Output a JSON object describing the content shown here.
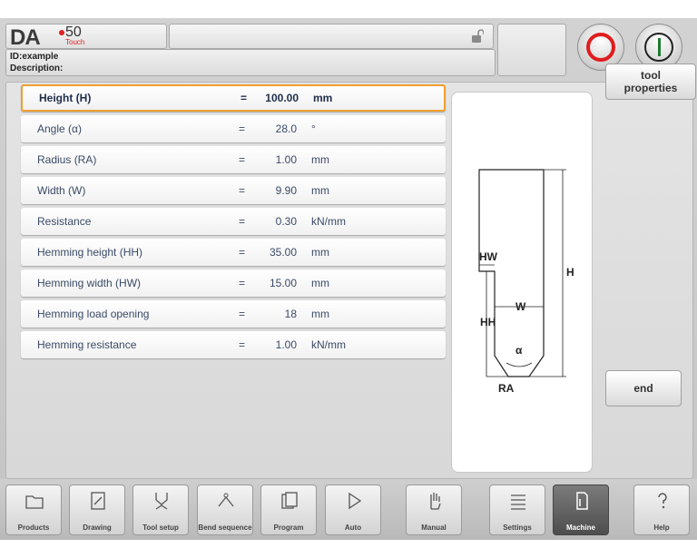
{
  "header": {
    "logo_brand": "DA",
    "logo_number": "50",
    "logo_sub": "Touch",
    "id_line": "ID:example",
    "description_line": "Description:"
  },
  "params": [
    {
      "label": "Height (H)",
      "eq": "=",
      "value": "100.00",
      "unit": "mm",
      "selected": true
    },
    {
      "label": "Angle (α)",
      "eq": "=",
      "value": "28.0",
      "unit": "°"
    },
    {
      "label": "Radius (RA)",
      "eq": "=",
      "value": "1.00",
      "unit": "mm"
    },
    {
      "label": "Width (W)",
      "eq": "=",
      "value": "9.90",
      "unit": "mm"
    },
    {
      "label": "Resistance",
      "eq": "=",
      "value": "0.30",
      "unit": "kN/mm"
    },
    {
      "label": "Hemming height (HH)",
      "eq": "=",
      "value": "35.00",
      "unit": "mm"
    },
    {
      "label": "Hemming width (HW)",
      "eq": "=",
      "value": "15.00",
      "unit": "mm"
    },
    {
      "label": "Hemming load opening",
      "eq": "=",
      "value": "18",
      "unit": "mm"
    },
    {
      "label": "Hemming resistance",
      "eq": "=",
      "value": "1.00",
      "unit": "kN/mm"
    }
  ],
  "drawing_labels": {
    "hw": "HW",
    "h": "H",
    "w": "W",
    "hh": "HH",
    "alpha": "α",
    "ra": "RA"
  },
  "side_buttons": {
    "tool_properties": "tool properties",
    "end": "end"
  },
  "nav": [
    {
      "label": "Products",
      "icon": "folder-icon"
    },
    {
      "label": "Drawing",
      "icon": "drawing-icon"
    },
    {
      "label": "Tool setup",
      "icon": "tool-setup-icon"
    },
    {
      "label": "Bend sequence",
      "icon": "bend-sequence-icon"
    },
    {
      "label": "Program",
      "icon": "program-icon"
    },
    {
      "label": "Auto",
      "icon": "play-icon"
    },
    {
      "label": "Manual",
      "icon": "hand-icon"
    },
    {
      "label": "Settings",
      "icon": "settings-icon"
    },
    {
      "label": "Machine",
      "icon": "machine-icon",
      "active": true
    },
    {
      "label": "Help",
      "icon": "help-icon"
    }
  ],
  "colors": {
    "selected_border": "#f0a030",
    "stop_red": "#e01d1d",
    "start_green": "#1f7a2c"
  }
}
